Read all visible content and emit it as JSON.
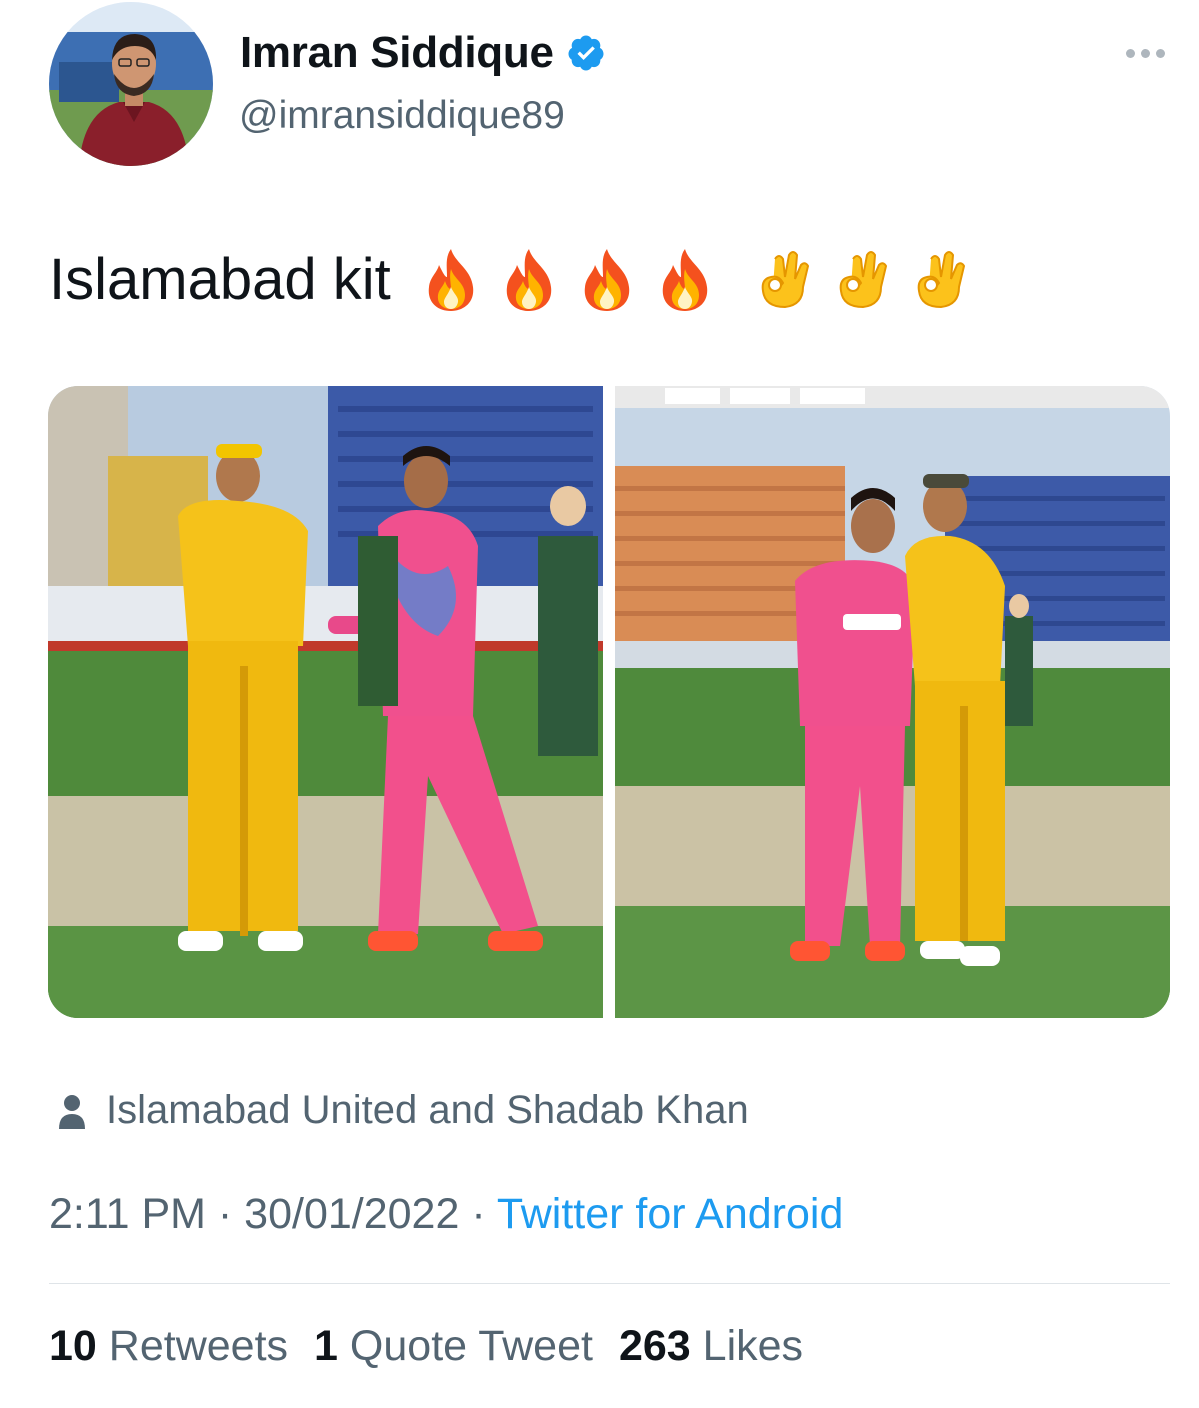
{
  "author": {
    "display_name": "Imran Siddique",
    "handle": "@imransiddique89",
    "verified": true
  },
  "icons": {
    "verified": "verified-badge-icon",
    "more": "more-options-icon",
    "person": "person-icon"
  },
  "tweet": {
    "text": "Islamabad kit",
    "emojis": [
      "fire",
      "fire",
      "fire",
      "fire",
      "ok-hand",
      "ok-hand",
      "ok-hand"
    ]
  },
  "media": {
    "photo_count": 2
  },
  "tagged": {
    "label": "Islamabad United and Shadab Khan"
  },
  "meta": {
    "time": "2:11 PM",
    "separator": " · ",
    "date": "30/01/2022",
    "source": "Twitter for Android"
  },
  "stats": {
    "retweets_count": "10",
    "retweets_label": "Retweets",
    "quotes_count": "1",
    "quotes_label": "Quote Tweet",
    "likes_count": "263",
    "likes_label": "Likes"
  },
  "colors": {
    "link": "#1d9bf0",
    "secondary_text": "#536471",
    "primary_text": "#0f1419",
    "verified": "#1d9bf0"
  }
}
